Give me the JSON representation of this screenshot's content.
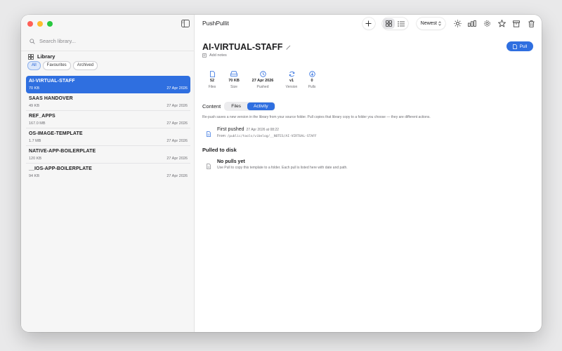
{
  "app": {
    "title": "PushPullit",
    "sort_label": "Newest"
  },
  "sidebar": {
    "search_placeholder": "Search library...",
    "library_label": "Library",
    "filters": [
      "All",
      "Favourites",
      "Archived"
    ],
    "items": [
      {
        "name": "AI-VIRTUAL-STAFF",
        "size": "70 KB",
        "date": "27 Apr 2026"
      },
      {
        "name": "SAAS HANDOVER",
        "size": "49 KB",
        "date": "27 Apr 2026"
      },
      {
        "name": "REF_APPS",
        "size": "167.0 MB",
        "date": "27 Apr 2026"
      },
      {
        "name": "OS-IMAGE-TEMPLATE",
        "size": "1.7 MB",
        "date": "27 Apr 2026"
      },
      {
        "name": "NATIVE-APP-BOILERPLATE",
        "size": "120 KB",
        "date": "27 Apr 2026"
      },
      {
        "name": "__IOS-APP-BOILERPLATE",
        "size": "94 KB",
        "date": "27 Apr 2026"
      }
    ]
  },
  "main": {
    "title": "AI-VIRTUAL-STAFF",
    "add_notes": "Add notes",
    "pull_label": "Pull",
    "stats": [
      {
        "value": "52",
        "label": "Files",
        "icon": "file-icon"
      },
      {
        "value": "70 KB",
        "label": "Size",
        "icon": "drive-icon"
      },
      {
        "value": "27 Apr 2026",
        "label": "Pushed",
        "icon": "clock-icon"
      },
      {
        "value": "v1",
        "label": "Version",
        "icon": "refresh-icon"
      },
      {
        "value": "0",
        "label": "Pulls",
        "icon": "download-icon"
      }
    ],
    "tabs_label": "Content",
    "tabs": [
      "Files",
      "Activity"
    ],
    "help_text": "Re-push saves a new version in the library from your source folder. Pull copies that library copy to a folder you choose — they are different actions.",
    "event": {
      "title": "First pushed",
      "date": "27 Apr 2026 at 08:22",
      "from_label": "From:",
      "path": "/public/tools/vibelog/__NOTES/AI-VIRTUAL-STAFF"
    },
    "pulled_title": "Pulled to disk",
    "no_pulls_title": "No pulls yet",
    "no_pulls_text": "Use Pull to copy this template to a folder. Each pull is listed here with date and path."
  },
  "colors": {
    "accent": "#2f6fe0",
    "sidebar_bg": "#f6f6f6"
  }
}
